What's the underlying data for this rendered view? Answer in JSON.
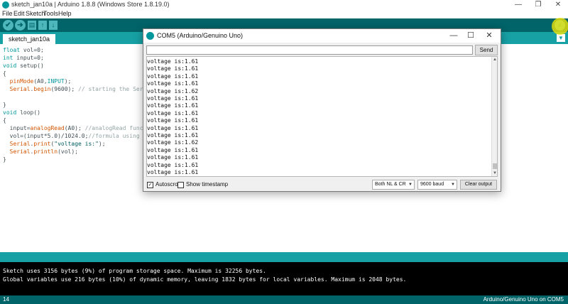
{
  "window": {
    "title": "sketch_jan10a | Arduino 1.8.8 (Windows Store 1.8.19.0)",
    "minimize": "—",
    "maximize": "❐",
    "close": "✕"
  },
  "menu": [
    "File",
    "Edit",
    "Sketch",
    "Tools",
    "Help"
  ],
  "toolbar": {
    "verify_icon": "✔",
    "upload_icon": "➔",
    "new_icon": "▤",
    "open_icon": "↑",
    "save_icon": "↓",
    "serial_icon": "⌕"
  },
  "tabs": {
    "active": "sketch_jan10a",
    "menu_icon": "▼"
  },
  "code": [
    {
      "kw": "float",
      "rest": " vol=0;"
    },
    {
      "kw": "int",
      "rest": " input=0;"
    },
    {
      "kw": "void",
      "rest": " setup()"
    },
    {
      "plain": "{"
    },
    {
      "indent": "  ",
      "fn": "pinMode",
      "rest": "(A0,",
      "const": "INPUT",
      "rest2": ");"
    },
    {
      "indent": "  ",
      "fn": "Serial",
      "rest": ".",
      "fn2": "begin",
      "rest2": "(9600); ",
      "comment": "// starting the Seri"
    },
    {
      "plain": ""
    },
    {
      "plain": "}"
    },
    {
      "kw": "void",
      "rest": " loop()"
    },
    {
      "plain": "{"
    },
    {
      "indent": "  ",
      "rest": "input=",
      "fn": "analogRead",
      "rest2": "(A0); ",
      "comment": "//analogRead funct"
    },
    {
      "indent": "  ",
      "rest": "vol=(input*5.0)/1024.0;",
      "comment": "//formula using r"
    },
    {
      "indent": "  ",
      "fn": "Serial",
      "rest": ".",
      "fn2": "print",
      "rest2": "(",
      "str": "\"voltage is:\"",
      "rest3": ");"
    },
    {
      "indent": "  ",
      "fn": "Serial",
      "rest": ".",
      "fn2": "println",
      "rest2": "(vol);"
    },
    {
      "plain": "}"
    }
  ],
  "console": {
    "line1": "Sketch uses 3156 bytes (9%) of program storage space. Maximum is 32256 bytes.",
    "line2": "Global variables use 216 bytes (10%) of dynamic memory, leaving 1832 bytes for local variables. Maximum is 2048 bytes."
  },
  "status": {
    "line_number": "14",
    "board": "Arduino/Genuino Uno on COM5"
  },
  "serial_monitor": {
    "title": "COM5 (Arduino/Genuino Uno)",
    "input_value": "",
    "send_label": "Send",
    "output": [
      "voltage is:1.61",
      "voltage is:1.61",
      "voltage is:1.61",
      "voltage is:1.61",
      "voltage is:1.62",
      "voltage is:1.61",
      "voltage is:1.61",
      "voltage is:1.61",
      "voltage is:1.61",
      "voltage is:1.61",
      "voltage is:1.61",
      "voltage is:1.62",
      "voltage is:1.61",
      "voltage is:1.61",
      "voltage is:1.61",
      "voltage is:1.61"
    ],
    "autoscroll_label": "Autoscroll",
    "autoscroll_checked": true,
    "timestamp_label": "Show timestamp",
    "timestamp_checked": false,
    "line_ending": "Both NL & CR",
    "baud_rate": "9600 baud",
    "clear_label": "Clear output"
  },
  "colors": {
    "toolbar": "#006468",
    "tabstrip": "#17a1a5",
    "accent": "#00979c"
  }
}
